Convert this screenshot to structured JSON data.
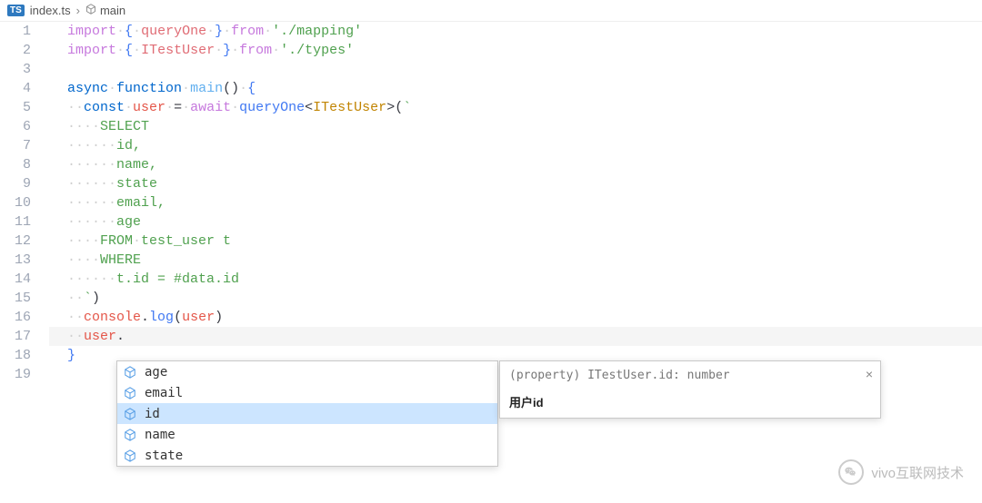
{
  "breadcrumb": {
    "ts_badge": "TS",
    "file": "index.ts",
    "symbol": "main"
  },
  "line_numbers": [
    "1",
    "2",
    "3",
    "4",
    "5",
    "6",
    "7",
    "8",
    "9",
    "10",
    "11",
    "12",
    "13",
    "14",
    "15",
    "16",
    "17",
    "18",
    "19"
  ],
  "code": {
    "l1_import": "import",
    "l1_open": "{",
    "l1_name": "queryOne",
    "l1_close": "}",
    "l1_from": "from",
    "l1_str": "'./mapping'",
    "l2_import": "import",
    "l2_open": "{",
    "l2_name": "ITestUser",
    "l2_close": "}",
    "l2_from": "from",
    "l2_str": "'./types'",
    "l4_async": "async",
    "l4_function": "function",
    "l4_name": "main",
    "l4_parens": "()",
    "l4_brace": "{",
    "l5_const": "const",
    "l5_user": "user",
    "l5_eq": "=",
    "l5_await": "await",
    "l5_call": "queryOne",
    "l5_lt": "<",
    "l5_type": "ITestUser",
    "l5_gt": ">",
    "l5_paren": "(",
    "l5_tick": "`",
    "l6": "SELECT",
    "l7": "id,",
    "l8": "name,",
    "l9": "state",
    "l10": "email,",
    "l11": "age",
    "l12_from": "FROM",
    "l12_rest": "test_user t",
    "l13": "WHERE",
    "l14": "t.id = #data.id",
    "l15_tick": "`",
    "l15_paren": ")",
    "l16_console": "console",
    "l16_dot": ".",
    "l16_log": "log",
    "l16_open": "(",
    "l16_arg": "user",
    "l16_close": ")",
    "l17_user": "user",
    "l17_dot": ".",
    "l18_brace": "}"
  },
  "autocomplete": {
    "items": [
      {
        "label": "age"
      },
      {
        "label": "email"
      },
      {
        "label": "id"
      },
      {
        "label": "name"
      },
      {
        "label": "state"
      }
    ],
    "selected_index": 2
  },
  "doc": {
    "signature": "(property) ITestUser.id: number",
    "description": "用户id"
  },
  "watermark": {
    "text": "vivo互联网技术"
  }
}
